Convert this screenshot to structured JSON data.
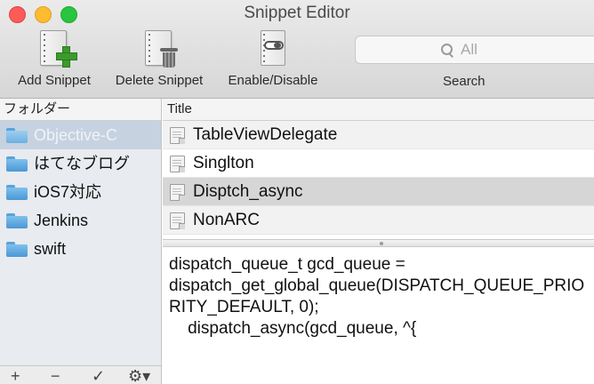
{
  "window": {
    "title": "Snippet Editor"
  },
  "toolbar": {
    "add_label": "Add Snippet",
    "delete_label": "Delete Snippet",
    "toggle_label": "Enable/Disable",
    "search_label": "Search",
    "search_placeholder": "All"
  },
  "sidebar": {
    "header": "フォルダー",
    "folders": [
      {
        "label": "Objective-C",
        "selected": true
      },
      {
        "label": "はてなブログ"
      },
      {
        "label": "iOS7対応"
      },
      {
        "label": "Jenkins"
      },
      {
        "label": "swift"
      }
    ],
    "footer": {
      "add": "+",
      "remove": "−",
      "check": "✓",
      "gear": "⚙▾"
    }
  },
  "snippet_list": {
    "header": "Title",
    "items": [
      {
        "title": "TableViewDelegate"
      },
      {
        "title": "Singlton"
      },
      {
        "title": "Disptch_async",
        "selected": true
      },
      {
        "title": "NonARC"
      }
    ]
  },
  "editor": {
    "lines": [
      "dispatch_queue_t gcd_queue =",
      "dispatch_get_global_queue(DISPATCH_QUEUE_PRIO",
      "RITY_DEFAULT, 0);",
      "    dispatch_async(gcd_queue, ^{"
    ]
  },
  "colors": {
    "selected_folder_bg": "#c6d2e0",
    "selected_row_bg": "#d6d6d6",
    "folder_icon": "#58a3da",
    "add_icon": "#3c9a2c"
  }
}
